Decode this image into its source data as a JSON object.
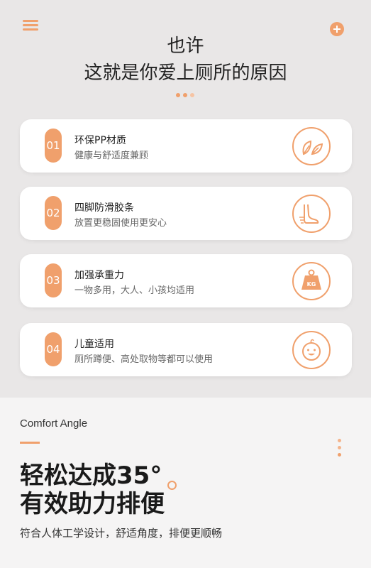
{
  "header": {
    "menu_icon": "hamburger-menu-icon",
    "add_icon": "plus-circle-icon",
    "title_line1": "也许",
    "title_line2": "这就是你爱上厕所的原因"
  },
  "features": [
    {
      "num": "01",
      "title": "环保PP材质",
      "desc": "健康与舒适度兼顾",
      "icon": "leaf-icon"
    },
    {
      "num": "02",
      "title": "四脚防滑胶条",
      "desc": "放置更稳固使用更安心",
      "icon": "foot-icon"
    },
    {
      "num": "03",
      "title": "加强承重力",
      "desc": "一物多用，大人、小孩均适用",
      "icon": "weight-kg-icon",
      "icon_text": "KG"
    },
    {
      "num": "04",
      "title": "儿童适用",
      "desc": "厕所蹲便、高处取物等都可以使用",
      "icon": "baby-face-icon"
    }
  ],
  "comfort": {
    "subtitle": "Comfort Angle",
    "headline_line1": "轻松达成35°",
    "headline_line2": "有效助力排便",
    "description": "符合人体工学设计，舒适角度，排便更顺畅"
  },
  "colors": {
    "accent": "#f0a06c",
    "top_background": "#e9e7e7",
    "bottom_background": "#f5f4f4"
  }
}
